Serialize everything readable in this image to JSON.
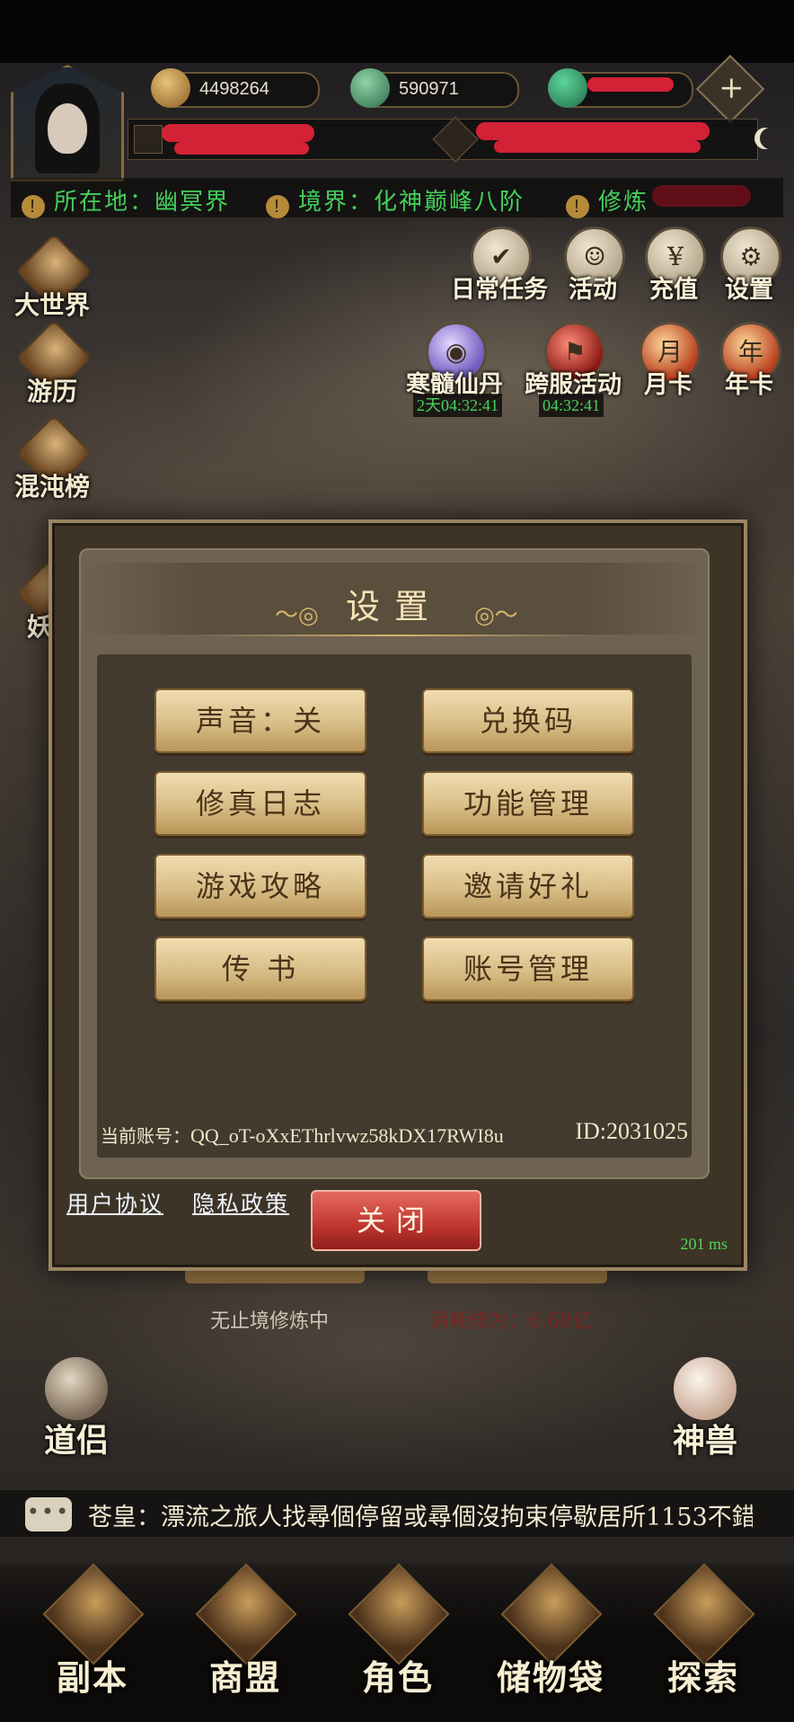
{
  "topbar": {
    "resources": [
      {
        "name": "gold-ingot-icon",
        "value": "4498264"
      },
      {
        "name": "jade-icon",
        "value": "590971"
      },
      {
        "name": "currency-icon",
        "value": ""
      }
    ],
    "plus_label": "+"
  },
  "info": {
    "location_label": "所在地：幽冥界",
    "realm_label": "境界：化神巅峰八阶",
    "cultivation_label": "修炼",
    "alert_glyph": "!"
  },
  "left_menu": [
    {
      "label": "大世界"
    },
    {
      "label": "游历"
    },
    {
      "label": "混沌榜"
    },
    {
      "label": "妖魔"
    }
  ],
  "top_icons": [
    {
      "label": "日常任务",
      "glyph": "✔"
    },
    {
      "label": "活动",
      "glyph": "☺"
    },
    {
      "label": "充值",
      "glyph": "¥"
    },
    {
      "label": "设置",
      "glyph": "⚙"
    },
    {
      "label": "寒髓仙丹",
      "glyph": "◉",
      "timer": "2天04:32:41"
    },
    {
      "label": "跨服活动",
      "glyph": "⚑",
      "timer": "04:32:41"
    },
    {
      "label": "月卡",
      "glyph": "月"
    },
    {
      "label": "年卡",
      "glyph": "年"
    }
  ],
  "background_status": {
    "left": "无止境修炼中",
    "right": "消耗修为：6.68亿"
  },
  "dialog": {
    "title": "设置",
    "buttons": [
      {
        "label": "声音：关"
      },
      {
        "label": "兑换码"
      },
      {
        "label": "修真日志"
      },
      {
        "label": "功能管理"
      },
      {
        "label": "游戏攻略"
      },
      {
        "label": "邀请好礼"
      },
      {
        "label": "传 书"
      },
      {
        "label": "账号管理"
      }
    ],
    "account_label": "当前账号：",
    "account_value": "QQ_oT-oXxEThrlvwz58kDX17RWI8u",
    "id_value": "ID:2031025",
    "user_agreement": "用户协议",
    "privacy_policy": "隐私政策",
    "close_label": "关闭",
    "ping": "201 ms"
  },
  "side": {
    "companion": "道侣",
    "beast": "神兽"
  },
  "chat": {
    "icon_glyph": "•••",
    "message": "苍皇：漂流之旅人找尋個停留或尋個沒拘束停歇居所1153不錯"
  },
  "nav": [
    {
      "label": "副本"
    },
    {
      "label": "商盟"
    },
    {
      "label": "角色"
    },
    {
      "label": "储物袋"
    },
    {
      "label": "探索"
    }
  ],
  "colors": {
    "accent_green": "#43d05a",
    "close_red": "#c0362f",
    "button_gold": "#d8bd86",
    "redaction": "#e4233a"
  }
}
